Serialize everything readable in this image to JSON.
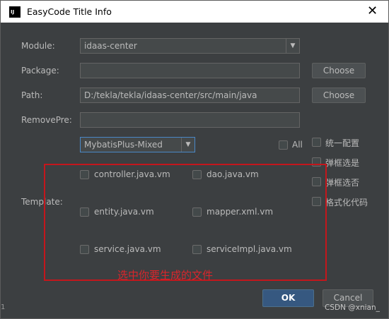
{
  "window": {
    "title": "EasyCode Title Info",
    "app_icon": "IJ",
    "close_glyph": "✕"
  },
  "form": {
    "module_label": "Module:",
    "module_value": "idaas-center",
    "package_label": "Package:",
    "package_value": "",
    "package_choose": "Choose",
    "path_label": "Path:",
    "path_value": "D:/tekla/tekla/idaas-center/src/main/java",
    "path_choose": "Choose",
    "removepre_label": "RemovePre:",
    "removepre_value": "",
    "group_value": "MybatisPlus-Mixed",
    "all_label": "All",
    "template_label": "Template:"
  },
  "templates": [
    {
      "name": "controller.java.vm",
      "checked": false
    },
    {
      "name": "dao.java.vm",
      "checked": false
    },
    {
      "name": "entity.java.vm",
      "checked": false
    },
    {
      "name": "mapper.xml.vm",
      "checked": false
    },
    {
      "name": "service.java.vm",
      "checked": false
    },
    {
      "name": "serviceImpl.java.vm",
      "checked": false
    }
  ],
  "options": [
    {
      "label": "统一配置",
      "checked": false
    },
    {
      "label": "弹框选是",
      "checked": false
    },
    {
      "label": "弹框选否",
      "checked": false
    },
    {
      "label": "格式化代码",
      "checked": false
    }
  ],
  "annotation": "选中你要生成的文件",
  "buttons": {
    "ok": "OK",
    "cancel": "Cancel"
  },
  "watermark": "CSDN @xnian_",
  "edge_digit": "1",
  "colors": {
    "dialog_bg": "#3c3f41",
    "field_bg": "#45494a",
    "ok_bg": "#365880",
    "annotation_red": "#d9262c"
  }
}
